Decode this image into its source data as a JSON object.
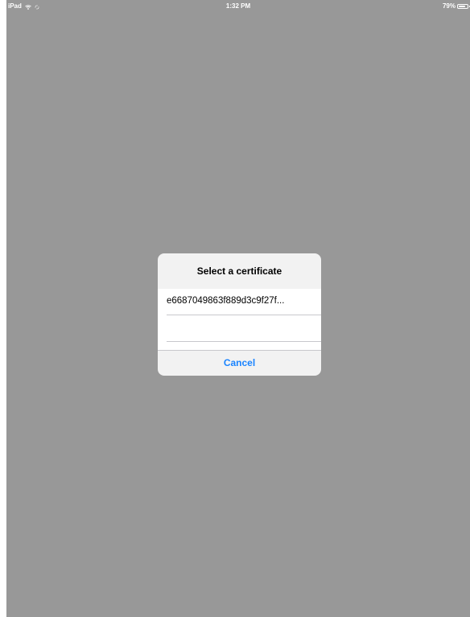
{
  "status_bar": {
    "device": "iPad",
    "time": "1:32 PM",
    "battery_percent": "79%",
    "battery_level": 0.79,
    "icons": [
      "wifi-icon",
      "loading-spinner-icon",
      "battery-icon"
    ]
  },
  "alert": {
    "title": "Select a certificate",
    "certificates": [
      "e6687049863f889d3c9f27f...",
      ""
    ],
    "cancel_label": "Cancel"
  },
  "colors": {
    "dim_background": "#989898",
    "alert_background": "#f2f2f2",
    "accent": "#1a84ff"
  }
}
